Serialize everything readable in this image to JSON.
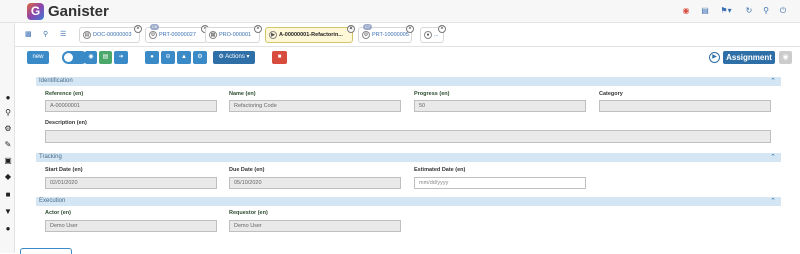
{
  "app": {
    "title": "Ganister",
    "logo_letter": "G"
  },
  "topbar_icons": [
    "notification-icon",
    "document-icon",
    "flag-en-icon",
    "refresh-icon",
    "search-icon",
    "power-icon"
  ],
  "rail_icons": [
    "user-icon",
    "search-user-icon",
    "gears-icon",
    "pencil-icon",
    "factory-icon",
    "tag-icon",
    "folder-icon",
    "cart-icon",
    "users-icon"
  ],
  "tabs": [
    {
      "label": "DOC-00000003",
      "badge": "",
      "active": false
    },
    {
      "label": "PRT-00000027",
      "badge": "C6",
      "active": false
    },
    {
      "label": "PRO-000001",
      "badge": "",
      "active": false
    },
    {
      "label": "A-00000001-Refactorin...",
      "badge": "",
      "active": true
    },
    {
      "label": "PRT-10000005",
      "badge": "C7",
      "active": false
    },
    {
      "label": "...",
      "badge": "",
      "active": false
    }
  ],
  "toolbar": {
    "new_label": "new",
    "actions_label": "Actions",
    "assignment_label": "Assignment"
  },
  "sections": {
    "identification": "Identification",
    "tracking": "Tracking",
    "execution": "Execution"
  },
  "fields": {
    "reference": {
      "label": "Reference (en)",
      "value": "A-00000001"
    },
    "name": {
      "label": "Name (en)",
      "value": "Refactoring Code"
    },
    "progress": {
      "label": "Progress (en)",
      "value": "50"
    },
    "category": {
      "label": "Category",
      "value": ""
    },
    "description": {
      "label": "Description (en)",
      "value": ""
    },
    "start_date": {
      "label": "Start Date (en)",
      "value": "02/01/2020"
    },
    "due_date": {
      "label": "Due Date (en)",
      "value": "05/10/2020"
    },
    "estimated_date": {
      "label": "Estimated Date (en)",
      "placeholder": "mm/dd/yyyy"
    },
    "actor": {
      "label": "Actor (en)",
      "value": "Demo User"
    },
    "requestor": {
      "label": "Requestor (en)",
      "value": "Demo User"
    }
  },
  "colors": {
    "accent": "#3a8ac8",
    "section_bg": "#d4e6f3",
    "assign": "#2f6fa8"
  }
}
